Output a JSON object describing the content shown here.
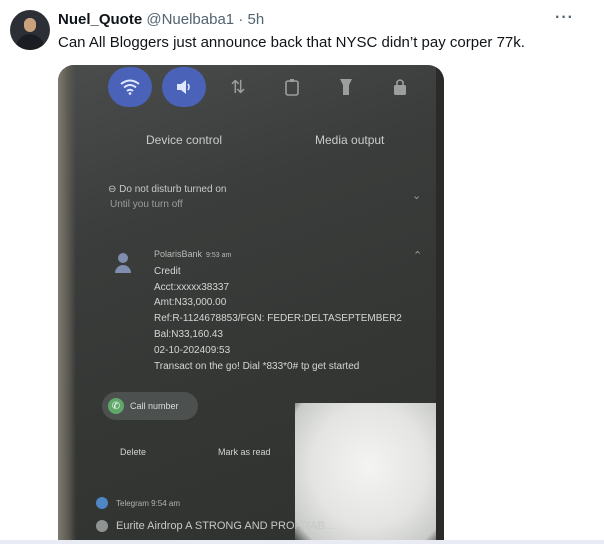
{
  "tweet": {
    "display_name": "Nuel_Quote",
    "handle": "@Nuelbaba1",
    "separator": "·",
    "time": "5h",
    "more": "···",
    "text": "Can All Bloggers just announce back that NYSC didn’t pay corper 77k."
  },
  "photo": {
    "quick_settings": [
      "wifi-icon",
      "sound-icon",
      "data-transfer-icon",
      "rotate-lock-icon",
      "flashlight-icon",
      "lock-icon"
    ],
    "device_control": "Device control",
    "media_output": "Media output",
    "dnd_title": "⊖  Do not disturb turned on",
    "dnd_sub": "Until you turn off",
    "notification": {
      "app": "PolarisBank",
      "time": "9:53 am",
      "lines": [
        "Credit",
        "Acct:xxxxx38337",
        "Amt:N33,000.00",
        "Ref:R-1124678853/FGN: FEDER:DELTASEPTEMBER2",
        "Bal:N33,160.43",
        "02-10-202409:53",
        "Transact on the go! Dial *833*0# tp get started"
      ]
    },
    "call_number": "Call number",
    "delete": "Delete",
    "mark_as_read": "Mark as read",
    "telegram": "Telegram  9:54 am",
    "eurite": "Eurite Airdrop  A STRONG AND PROFITAB..."
  },
  "colors": {
    "name": "#0f1419",
    "muted": "#536471",
    "qs_on": "#4a63b8"
  }
}
